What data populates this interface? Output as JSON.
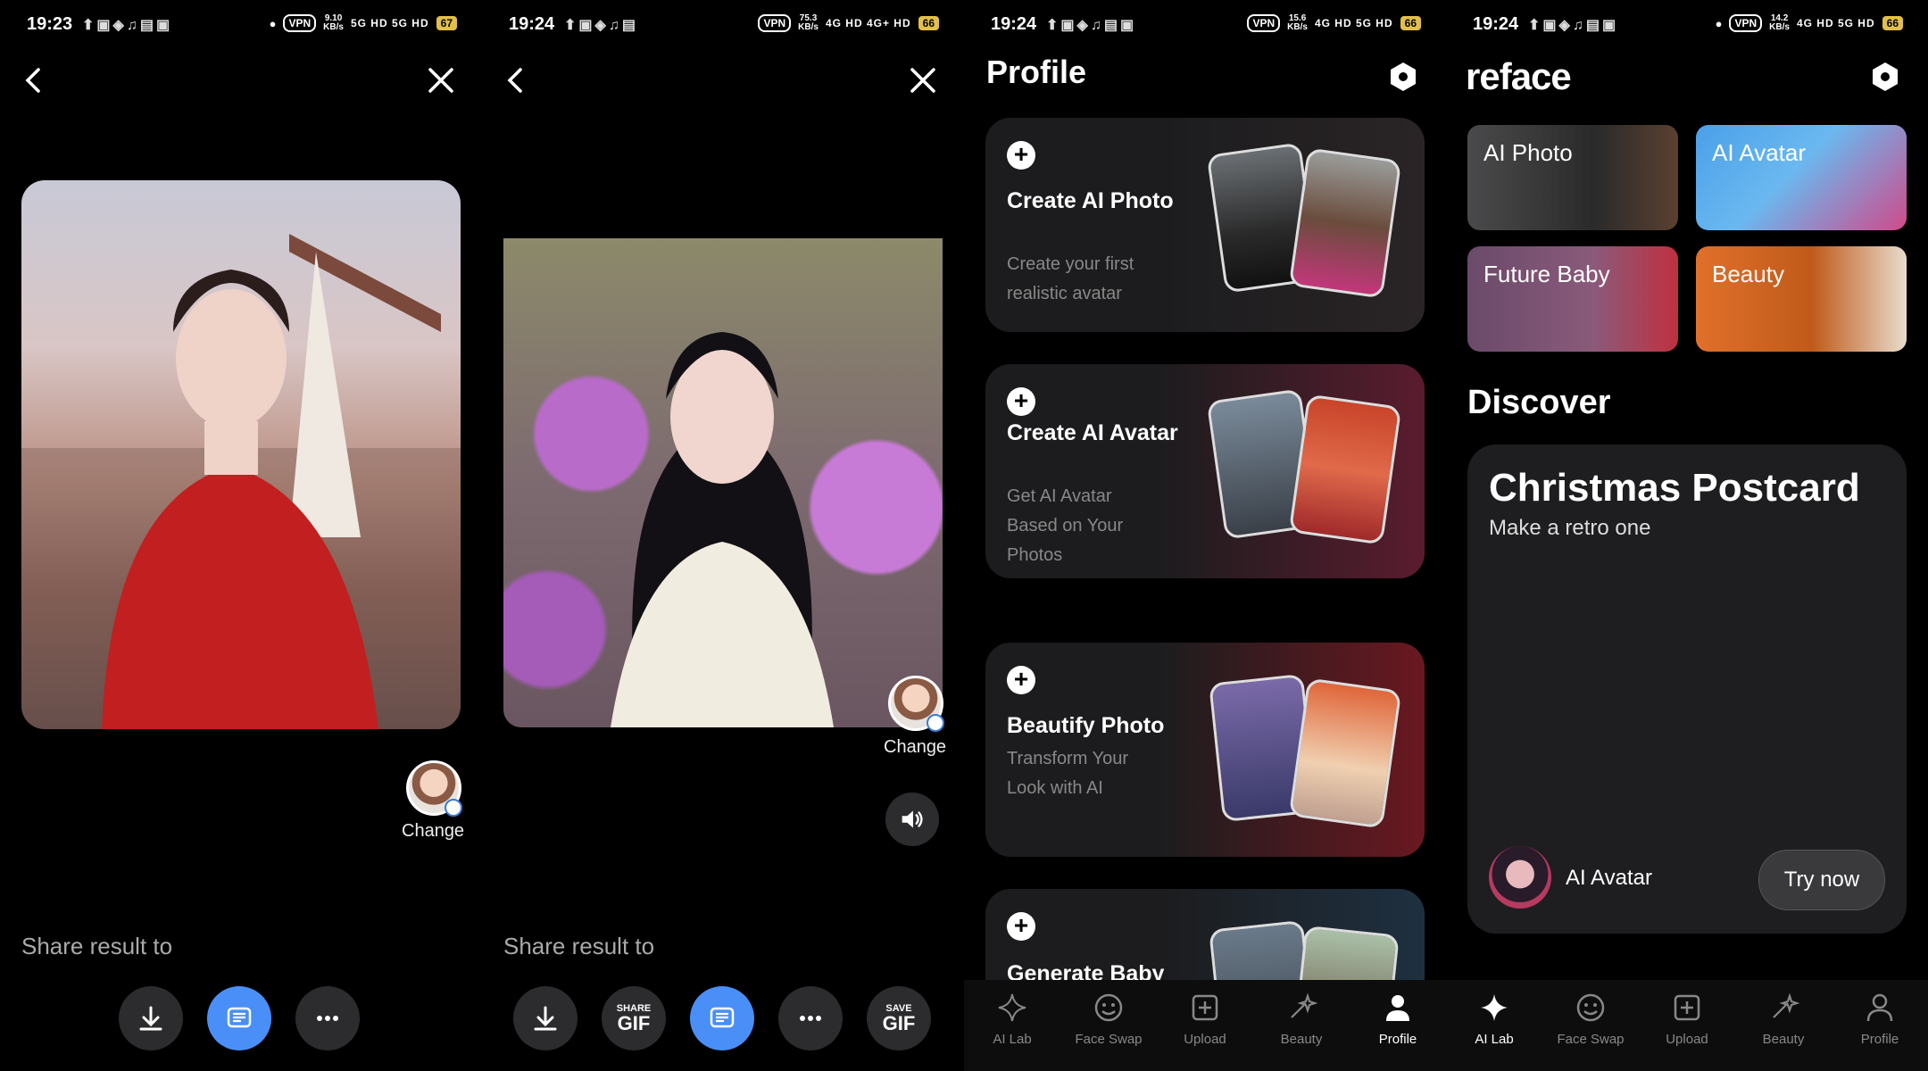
{
  "status_bars": [
    {
      "time": "19:23",
      "speed_top": "9.10",
      "speed_bottom": "KB/s",
      "signal": "5G HD 5G HD",
      "battery": "67"
    },
    {
      "time": "19:24",
      "speed_top": "75.3",
      "speed_bottom": "KB/s",
      "signal": "4G HD 4G+ HD",
      "battery": "66"
    },
    {
      "time": "19:24",
      "speed_top": "15.6",
      "speed_bottom": "KB/s",
      "signal": "4G HD 5G HD",
      "battery": "66"
    },
    {
      "time": "19:24",
      "speed_top": "14.2",
      "speed_bottom": "KB/s",
      "signal": "4G HD 5G HD",
      "battery": "66"
    }
  ],
  "vpn_label": "VPN",
  "result_screens": {
    "change_label": "Change",
    "share_label": "Share result to",
    "share_gif": {
      "small": "SHARE",
      "big": "GIF"
    },
    "save_gif": {
      "small": "SAVE",
      "big": "GIF"
    }
  },
  "profile": {
    "title": "Profile",
    "cards": [
      {
        "title": "Create AI Photo",
        "subtitle": "Create your first realistic avatar"
      },
      {
        "title": "Create AI Avatar",
        "subtitle": "Get AI Avatar Based on Your Photos"
      },
      {
        "title": "Beautify Photo",
        "subtitle": "Transform Your Look with AI"
      },
      {
        "title": "Generate Baby",
        "subtitle": ""
      }
    ]
  },
  "home": {
    "logo": "reface",
    "categories": [
      "AI Photo",
      "AI Avatar",
      "Future Baby",
      "Beauty"
    ],
    "discover": "Discover",
    "promo": {
      "title": "Christmas Postcard",
      "subtitle": "Make a retro one",
      "feature": "AI Avatar",
      "cta": "Try now"
    }
  },
  "bottom_nav": [
    "AI Lab",
    "Face Swap",
    "Upload",
    "Beauty",
    "Profile"
  ],
  "colors": {
    "accent_blue": "#4a8ff7",
    "battery": "#e2c048",
    "background": "#000000"
  }
}
